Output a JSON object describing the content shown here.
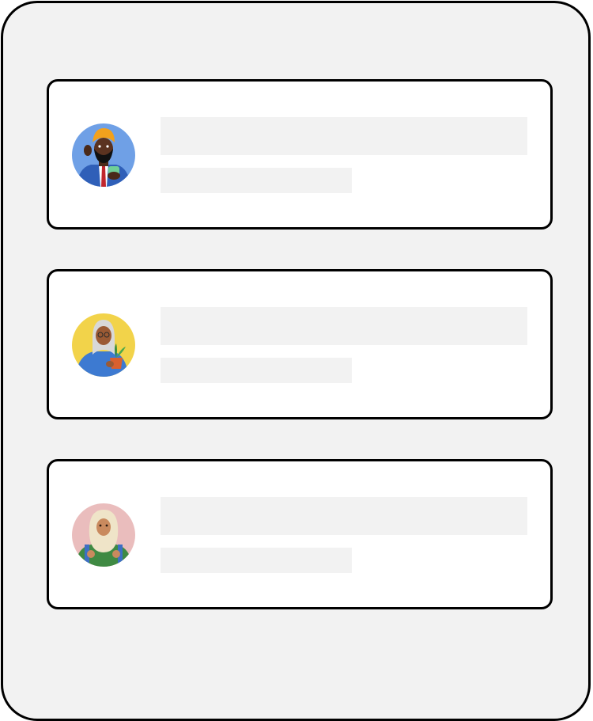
{
  "list": {
    "items": [
      {
        "avatar_icon": "man-turban-avatar-icon",
        "avatar_bg": "#6fa0e6",
        "title_text": "",
        "subtitle_text": ""
      },
      {
        "avatar_icon": "woman-plant-avatar-icon",
        "avatar_bg": "#f2d34a",
        "title_text": "",
        "subtitle_text": ""
      },
      {
        "avatar_icon": "woman-hijab-avatar-icon",
        "avatar_bg": "#eabdbd",
        "title_text": "",
        "subtitle_text": ""
      }
    ]
  },
  "colors": {
    "frame_bg": "#f2f2f2",
    "card_bg": "#ffffff",
    "border": "#000000",
    "placeholder": "#f2f2f2"
  }
}
